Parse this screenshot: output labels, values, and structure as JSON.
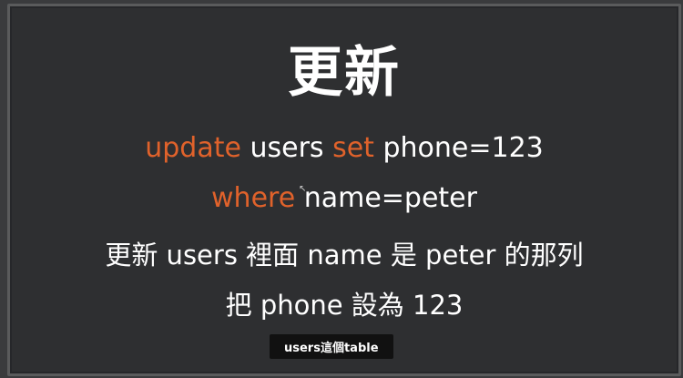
{
  "slide": {
    "title": "更新",
    "line1": {
      "kw1": "update",
      "t1": " users ",
      "kw2": "set",
      "t2": " phone=123"
    },
    "line2": {
      "kw1": "where",
      "t1": " name=peter"
    },
    "line3": "更新 users 裡面 name 是 peter 的那列",
    "line4": "把 phone 設為 123"
  },
  "caption": "users這個table",
  "colors": {
    "keyword": "#e0622b",
    "text": "#ffffff",
    "background": "#2e2f31"
  }
}
